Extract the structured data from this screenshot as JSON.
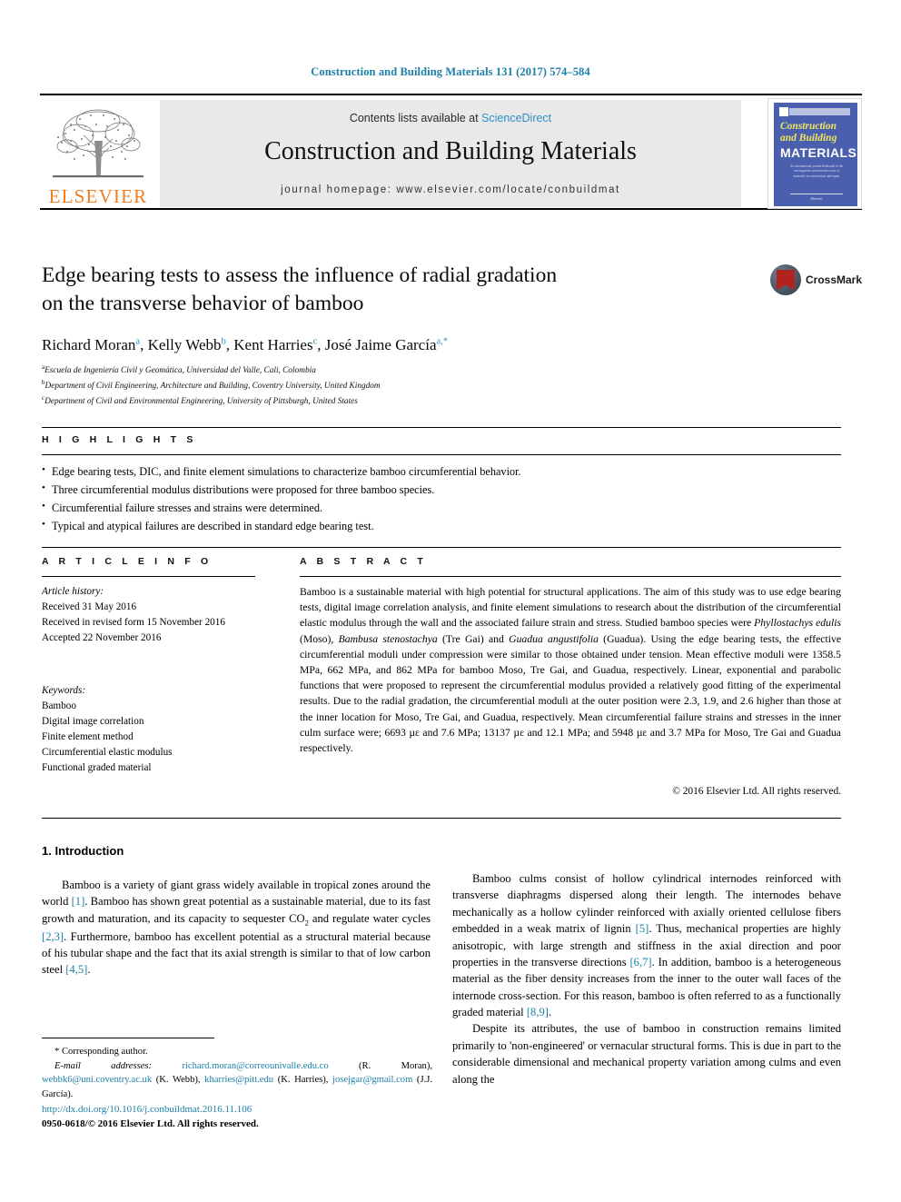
{
  "running_head": "Construction and Building Materials 131 (2017) 574–584",
  "masthead": {
    "publisher_logo_text": "ELSEVIER",
    "contents_prefix": "Contents lists available at ",
    "contents_link": "ScienceDirect",
    "journal_title": "Construction and Building Materials",
    "homepage_line": "journal homepage: www.elsevier.com/locate/conbuildmat",
    "cover": {
      "line1": "Construction",
      "line2": "and Building",
      "line3": "MATERIALS",
      "blurb": "An international journal dedicated to the investigation and innovative use of materials in construction and repair",
      "footer": "Elsevier"
    }
  },
  "article": {
    "title_line1": "Edge bearing tests to assess the influence of radial gradation",
    "title_line2": "on the transverse behavior of bamboo",
    "crossmark_label": "CrossMark",
    "authors": [
      {
        "name": "Richard Moran",
        "marks": "a"
      },
      {
        "name": "Kelly Webb",
        "marks": "b"
      },
      {
        "name": "Kent Harries",
        "marks": "c"
      },
      {
        "name": "José Jaime García",
        "marks": "a,*"
      }
    ],
    "affiliations": [
      {
        "mark": "a",
        "text": "Escuela de Ingeniería Civil y Geomática, Universidad del Valle, Cali, Colombia"
      },
      {
        "mark": "b",
        "text": "Department of Civil Engineering, Architecture and Building, Coventry University, United Kingdom"
      },
      {
        "mark": "c",
        "text": "Department of Civil and Environmental Engineering, University of Pittsburgh, United States"
      }
    ]
  },
  "highlights": {
    "heading": "H I G H L I G H T S",
    "items": [
      "Edge bearing tests, DIC, and finite element simulations to characterize bamboo circumferential behavior.",
      "Three circumferential modulus distributions were proposed for three bamboo species.",
      "Circumferential failure stresses and strains were determined.",
      "Typical and atypical failures are described in standard edge bearing test."
    ]
  },
  "article_info": {
    "heading": "A R T I C L E   I N F O",
    "history_label": "Article history:",
    "history": [
      "Received 31 May 2016",
      "Received in revised form 15 November 2016",
      "Accepted 22 November 2016"
    ],
    "keywords_label": "Keywords:",
    "keywords": [
      "Bamboo",
      "Digital image correlation",
      "Finite element method",
      "Circumferential elastic modulus",
      "Functional graded material"
    ]
  },
  "abstract": {
    "heading": "A B S T R A C T",
    "text_part1": "Bamboo is a sustainable material with high potential for structural applications. The aim of this study was to use edge bearing tests, digital image correlation analysis, and finite element simulations to research about the distribution of the circumferential elastic modulus through the wall and the associated failure strain and stress. Studied bamboo species were ",
    "species1": "Phyllostachys edulis",
    "text_part2": " (Moso), ",
    "species2": "Bambusa stenostachya",
    "text_part3": " (Tre Gai) and ",
    "species3": "Guadua angustifolia",
    "text_part4": " (Guadua). Using the edge bearing tests, the effective circumferential moduli under compression were similar to those obtained under tension. Mean effective moduli were 1358.5 MPa, 662 MPa, and 862 MPa for bamboo Moso, Tre Gai, and Guadua, respectively. Linear, exponential and parabolic functions that were proposed to represent the circumferential modulus provided a relatively good fitting of the experimental results. Due to the radial gradation, the circumferential moduli at the outer position were 2.3, 1.9, and 2.6 higher than those at the inner location for Moso, Tre Gai, and Guadua, respectively. Mean circumferential failure strains and stresses in the inner culm surface were; 6693 µε and 7.6 MPa; 13137 µε and 12.1 MPa; and 5948 µε and 3.7 MPa for Moso, Tre Gai and Guadua respectively.",
    "copyright": "© 2016 Elsevier Ltd. All rights reserved."
  },
  "introduction": {
    "heading": "1. Introduction",
    "left_p1_a": "Bamboo is a variety of giant grass widely available in tropical zones around the world ",
    "left_ref1": "[1]",
    "left_p1_b": ". Bamboo has shown great potential as a sustainable material, due to its fast growth and maturation, and its capacity to sequester CO",
    "left_sub": "2",
    "left_p1_c": " and regulate water cycles ",
    "left_ref2": "[2,3]",
    "left_p1_d": ". Furthermore, bamboo has excellent potential as a structural material because of his tubular shape and the fact that its axial strength is similar to that of low carbon steel ",
    "left_ref3": "[4,5]",
    "left_p1_e": ".",
    "right_p1_a": "Bamboo culms consist of hollow cylindrical internodes reinforced with transverse diaphragms dispersed along their length. The internodes behave mechanically as a hollow cylinder reinforced with axially oriented cellulose fibers embedded in a weak matrix of lignin ",
    "right_ref1": "[5]",
    "right_p1_b": ". Thus, mechanical properties are highly anisotropic, with large strength and stiffness in the axial direction and poor properties in the transverse directions ",
    "right_ref2": "[6,7]",
    "right_p1_c": ". In addition, bamboo is a heterogeneous material as the fiber density increases from the inner to the outer wall faces of the internode cross-section. For this reason, bamboo is often referred to as a functionally graded material ",
    "right_ref3": "[8,9]",
    "right_p1_d": ".",
    "right_p2": "Despite its attributes, the use of bamboo in construction remains limited primarily to 'non-engineered' or vernacular structural forms. This is due in part to the considerable dimensional and mechanical property variation among culms and even along the"
  },
  "footnote": {
    "corresponding": "* Corresponding author.",
    "email_label": "E-mail addresses:",
    "email1": "richard.moran@correounivalle.edu.co",
    "email1_owner": "(R. Moran),",
    "email2": "webbk6@uni.coventry.ac.uk",
    "email2_owner": "(K. Webb),",
    "email3": "kharries@pitt.edu",
    "email3_owner": "(K. Harries),",
    "email4": "josejgar@gmail.com",
    "email4_owner": "(J.J. García)."
  },
  "publication_footer": {
    "doi": "http://dx.doi.org/10.1016/j.conbuildmat.2016.11.106",
    "issn_line": "0950-0618/© 2016 Elsevier Ltd. All rights reserved."
  }
}
